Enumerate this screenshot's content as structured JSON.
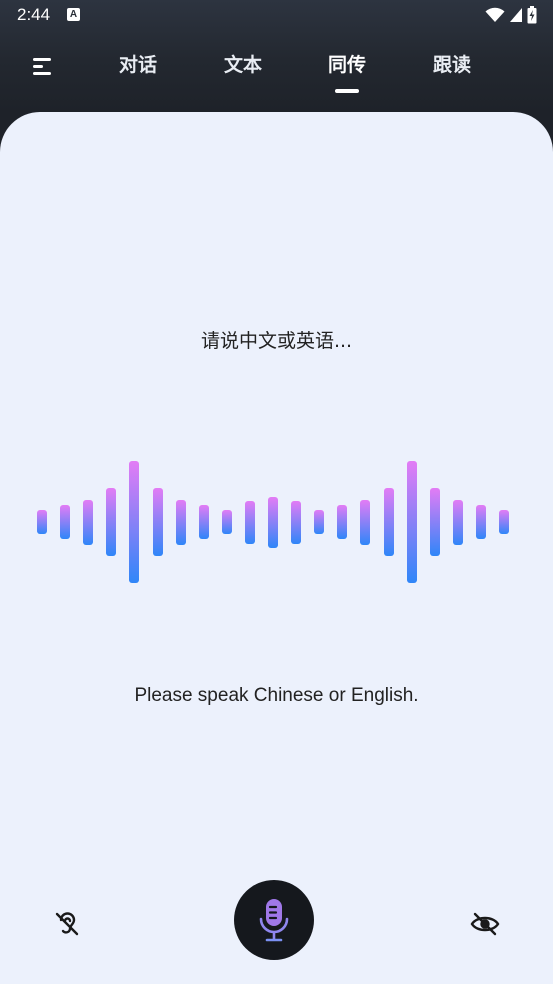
{
  "status_bar": {
    "time": "2:44",
    "app_badge": "A",
    "icons": [
      "wifi-icon",
      "signal-icon",
      "battery-icon"
    ]
  },
  "nav": {
    "menu_icon": "menu-icon",
    "tabs": [
      {
        "label": "对话"
      },
      {
        "label": "文本"
      },
      {
        "label": "同传",
        "active": true
      },
      {
        "label": "跟读"
      }
    ]
  },
  "main": {
    "prompt_cn": "请说中文或英语...",
    "prompt_en": "Please speak Chinese or English.",
    "waveform_levels": [
      0.2,
      0.28,
      0.37,
      0.56,
      1.0,
      0.56,
      0.37,
      0.28,
      0.2,
      0.35,
      0.42,
      0.35,
      0.2,
      0.28,
      0.37,
      0.56,
      1.0,
      0.56,
      0.37,
      0.28,
      0.2
    ],
    "waveform_colors": {
      "top": "#e37cf5",
      "bottom": "#2f86f8"
    }
  },
  "controls": {
    "left_icon": "ear-off-icon",
    "center_icon": "microphone-icon",
    "right_icon": "eye-off-icon",
    "mic_color": "#a078e8"
  }
}
